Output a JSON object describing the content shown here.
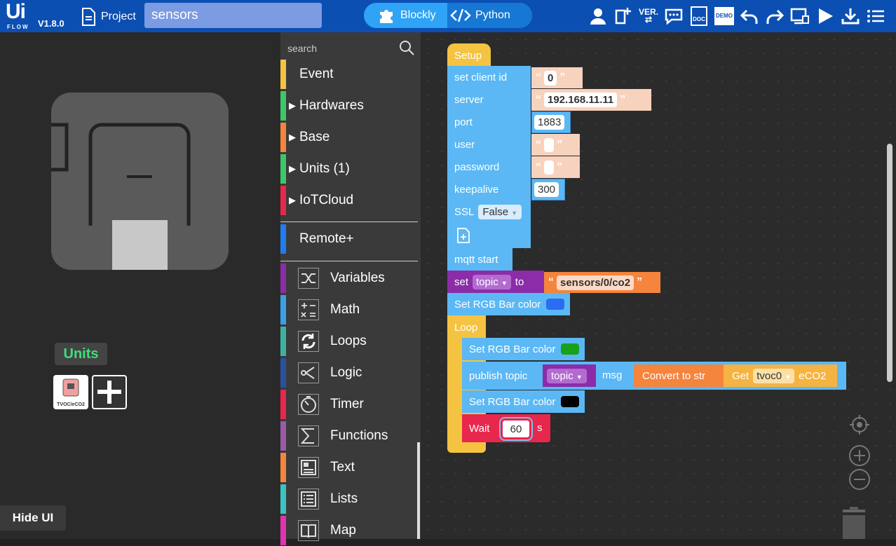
{
  "header": {
    "logo_text": "Ui",
    "logo_sub": "FLOW",
    "version": "V1.8.0",
    "project_label": "Project",
    "project_name": "sensors",
    "mode_blockly": "Blockly",
    "mode_python": "Python",
    "tools": [
      "user-icon",
      "new-file-icon",
      "version-icon",
      "chat-icon",
      "doc-icon",
      "demo-icon",
      "undo-icon",
      "redo-icon",
      "device-icon",
      "run-icon",
      "download-icon",
      "menu-icon"
    ],
    "tool_version_text": "VER.",
    "tool_doc_text": "DOC",
    "tool_demo_text": "DEMO"
  },
  "left": {
    "units_label": "Units",
    "unit_tile_caption": "TVOC/eCO2",
    "hide_ui": "Hide UI"
  },
  "toolbox": {
    "search_placeholder": "search",
    "categories": [
      {
        "label": "Event",
        "color": "#f5c342",
        "expand": false
      },
      {
        "label": "Hardwares",
        "color": "#3cc768",
        "expand": true
      },
      {
        "label": "Base",
        "color": "#f5843d",
        "expand": true
      },
      {
        "label": "Units (1)",
        "color": "#3cc768",
        "expand": true
      },
      {
        "label": "IoTCloud",
        "color": "#e8274d",
        "expand": true
      },
      {
        "label": "Remote+",
        "color": "#1e7df0",
        "expand": false
      }
    ],
    "tools": [
      {
        "label": "Variables",
        "color": "#8b2ca8",
        "icon": "shuffle-icon"
      },
      {
        "label": "Math",
        "color": "#3aa0e6",
        "icon": "math-icon"
      },
      {
        "label": "Loops",
        "color": "#3cb3a0",
        "icon": "loop-icon"
      },
      {
        "label": "Logic",
        "color": "#2a50a0",
        "icon": "logic-icon"
      },
      {
        "label": "Timer",
        "color": "#e8274d",
        "icon": "timer-icon"
      },
      {
        "label": "Functions",
        "color": "#9a5aa8",
        "icon": "sigma-icon"
      },
      {
        "label": "Text",
        "color": "#f5843d",
        "icon": "text-icon"
      },
      {
        "label": "Lists",
        "color": "#3cc3c0",
        "icon": "list-icon"
      },
      {
        "label": "Map",
        "color": "#e033b0",
        "icon": "book-icon"
      }
    ]
  },
  "blocks": {
    "setup": "Setup",
    "client_id_label": "set client id",
    "client_id_value": "0",
    "server_label": "server",
    "server_value": "192.168.11.11",
    "port_label": "port",
    "port_value": "1883",
    "user_label": "user",
    "password_label": "password",
    "keepalive_label": "keepalive",
    "keepalive_value": "300",
    "ssl_label": "SSL",
    "ssl_value": "False",
    "mqtt_start": "mqtt start",
    "set_label": "set",
    "set_var": "topic",
    "to_label": "to",
    "topic_value": "sensors/0/co2",
    "rgb_label": "Set RGB Bar color",
    "rgb_color_1": "#2b6cf0",
    "loop": "Loop",
    "rgb_color_2": "#1aa01a",
    "publish_label": "publish topic",
    "publish_var": "topic",
    "msg_label": "msg",
    "convert_label": "Convert to str",
    "get_label": "Get",
    "get_sensor": "tvoc0",
    "get_field": "eCO2",
    "rgb_color_3": "#000000",
    "wait_label": "Wait",
    "wait_value": "60",
    "wait_unit": "s"
  },
  "colors": {
    "topbar": "#0c4fb3",
    "mqtt_block": "#5bb8f5",
    "setup_block": "#f5c342",
    "text_block": "#f5843d",
    "variable_block": "#8b2ca8",
    "timer_block": "#e8274d"
  }
}
